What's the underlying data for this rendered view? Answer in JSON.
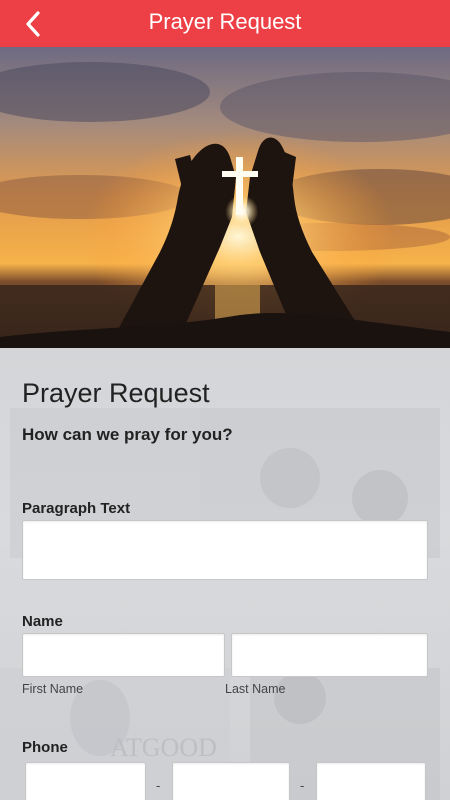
{
  "app_bar": {
    "title": "Prayer Request",
    "back_icon": "chevron-left-icon",
    "color": "#ec4046"
  },
  "hero": {
    "image_desc_icon": "praying-hands-cross-sunset-image"
  },
  "form": {
    "title": "Prayer Request",
    "subtitle": "How can we pray for you?",
    "paragraph": {
      "label": "Paragraph Text",
      "value": "",
      "placeholder": ""
    },
    "name": {
      "label": "Name",
      "first_label": "First Name",
      "last_label": "Last Name",
      "first_value": "",
      "last_value": ""
    },
    "phone": {
      "label": "Phone",
      "separator": "-",
      "area_value": "",
      "prefix_value": "",
      "line_value": ""
    }
  }
}
